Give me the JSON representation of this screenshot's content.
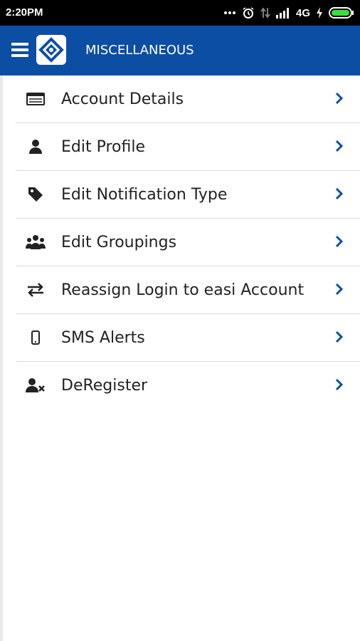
{
  "status_bar": {
    "time": "2:20PM",
    "network": "4G"
  },
  "app_bar": {
    "title": "MISCELLANEOUS"
  },
  "menu": {
    "items": [
      {
        "label": "Account Details",
        "icon": "account-card-icon"
      },
      {
        "label": "Edit Profile",
        "icon": "user-icon"
      },
      {
        "label": "Edit Notification Type",
        "icon": "tag-icon"
      },
      {
        "label": "Edit Groupings",
        "icon": "users-group-icon"
      },
      {
        "label": "Reassign Login to easi Account",
        "icon": "swap-arrows-icon"
      },
      {
        "label": "SMS Alerts",
        "icon": "mobile-phone-icon"
      },
      {
        "label": "DeRegister",
        "icon": "user-remove-icon"
      }
    ]
  },
  "colors": {
    "app_bar": "#0d4ea5",
    "chevron": "#0d4ea5",
    "text": "#222222"
  }
}
